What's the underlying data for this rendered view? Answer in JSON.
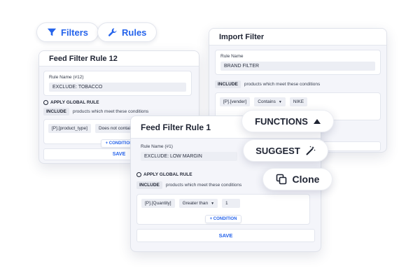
{
  "pills": {
    "filters_label": "Filters",
    "rules_label": "Rules"
  },
  "rule12": {
    "title": "Feed Filter Rule 12",
    "name_label": "Rule Name (#12)",
    "name_value": "EXCLUDE: TOBACCO",
    "global_rule": "APPLY GLOBAL RULE",
    "include": "INCLUDE",
    "include_text": "products which meet these conditions",
    "field": "[P].[product_type]",
    "operator": "Does not contain",
    "add_condition": "+ CONDITION",
    "save": "SAVE"
  },
  "import": {
    "title": "Import Filter",
    "name_label": "Rule Name",
    "name_value": "BRAND FILTER",
    "include": "INCLUDE",
    "include_text": "products which meet these conditions",
    "field": "[P].[vender]",
    "operator": "Contains",
    "value": "NIKE"
  },
  "rule1": {
    "title": "Feed Filter Rule 1",
    "name_label": "Rule Name (#1)",
    "name_value": "EXCLUDE: LOW MARGIN",
    "global_rule": "APPLY GLOBAL RULE",
    "include": "INCLUDE",
    "include_text": "products which meet these conditions",
    "field": "[P].[Quantity]",
    "operator": "Greater than",
    "value": "1",
    "add_condition": "+ CONDITION",
    "save": "SAVE"
  },
  "actions": {
    "functions": "FUNCTIONS",
    "suggest": "SUGGEST",
    "clone": "Clone"
  },
  "colors": {
    "accent": "#2563eb"
  }
}
